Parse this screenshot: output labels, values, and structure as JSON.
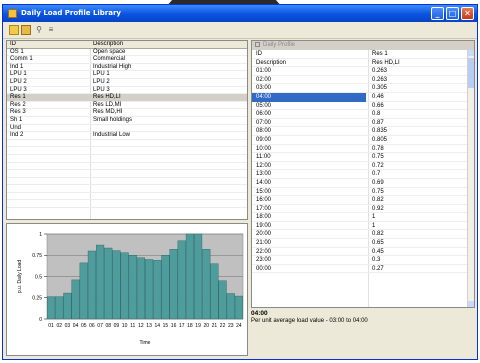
{
  "window": {
    "title": "Daily Load Profile Library"
  },
  "library": {
    "columns": [
      "ID",
      "Description"
    ],
    "rows": [
      {
        "id": "OS 1",
        "desc": "Open space"
      },
      {
        "id": "Comm 1",
        "desc": "Commercial"
      },
      {
        "id": "Ind 1",
        "desc": "Industrial High"
      },
      {
        "id": "LPU 1",
        "desc": "LPU 1"
      },
      {
        "id": "LPU 2",
        "desc": "LPU 2"
      },
      {
        "id": "LPU 3",
        "desc": "LPU 3"
      },
      {
        "id": "Res 1",
        "desc": "Res HD,LI"
      },
      {
        "id": "Res 2",
        "desc": "Res LD,MI"
      },
      {
        "id": "Res 3",
        "desc": "Res MD,HI"
      },
      {
        "id": "Sh 1",
        "desc": "Small holdings"
      },
      {
        "id": "Und",
        "desc": ""
      },
      {
        "id": "Ind 2",
        "desc": "Industrial Low"
      }
    ],
    "selected_index": 6
  },
  "profile": {
    "title": "Daily Profile",
    "rows": [
      {
        "k": "ID",
        "v": "Res 1"
      },
      {
        "k": "Description",
        "v": "Res HD,LI"
      },
      {
        "k": "01:00",
        "v": "0.263"
      },
      {
        "k": "02:00",
        "v": "0.263"
      },
      {
        "k": "03:00",
        "v": "0.305"
      },
      {
        "k": "04:00",
        "v": "0.46"
      },
      {
        "k": "05:00",
        "v": "0.66"
      },
      {
        "k": "06:00",
        "v": "0.8"
      },
      {
        "k": "07:00",
        "v": "0.87"
      },
      {
        "k": "08:00",
        "v": "0.835"
      },
      {
        "k": "09:00",
        "v": "0.805"
      },
      {
        "k": "10:00",
        "v": "0.78"
      },
      {
        "k": "11:00",
        "v": "0.75"
      },
      {
        "k": "12:00",
        "v": "0.72"
      },
      {
        "k": "13:00",
        "v": "0.7"
      },
      {
        "k": "14:00",
        "v": "0.69"
      },
      {
        "k": "15:00",
        "v": "0.75"
      },
      {
        "k": "16:00",
        "v": "0.82"
      },
      {
        "k": "17:00",
        "v": "0.92"
      },
      {
        "k": "18:00",
        "v": "1"
      },
      {
        "k": "19:00",
        "v": "1"
      },
      {
        "k": "20:00",
        "v": "0.82"
      },
      {
        "k": "21:00",
        "v": "0.65"
      },
      {
        "k": "22:00",
        "v": "0.45"
      },
      {
        "k": "23:00",
        "v": "0.3"
      },
      {
        "k": "00:00",
        "v": "0.27"
      }
    ],
    "selected_index": 5
  },
  "description": {
    "title": "04:00",
    "text": "Per unit average load value - 03:00 to 04:00"
  },
  "toolbar": {
    "icons": [
      "new-icon",
      "open-icon",
      "find-icon",
      "properties-icon"
    ]
  },
  "colors": {
    "bar": "#4f9c9c",
    "selection": "#316ac5",
    "titlebar": "#0a53e2"
  },
  "chart_data": {
    "type": "bar",
    "categories": [
      "01",
      "02",
      "03",
      "04",
      "05",
      "06",
      "07",
      "08",
      "09",
      "10",
      "11",
      "12",
      "13",
      "14",
      "15",
      "16",
      "17",
      "18",
      "19",
      "20",
      "21",
      "22",
      "23",
      "24"
    ],
    "values": [
      0.263,
      0.263,
      0.305,
      0.46,
      0.66,
      0.8,
      0.87,
      0.835,
      0.805,
      0.78,
      0.75,
      0.72,
      0.7,
      0.69,
      0.75,
      0.82,
      0.92,
      1,
      1,
      0.82,
      0.65,
      0.45,
      0.3,
      0.27
    ],
    "xlabel": "Time",
    "ylabel": "p.u. Daily Load",
    "ylim": [
      0,
      1
    ],
    "yticks": [
      "0",
      "0.25",
      "0.5",
      "0.75",
      "1"
    ],
    "grid": true
  }
}
